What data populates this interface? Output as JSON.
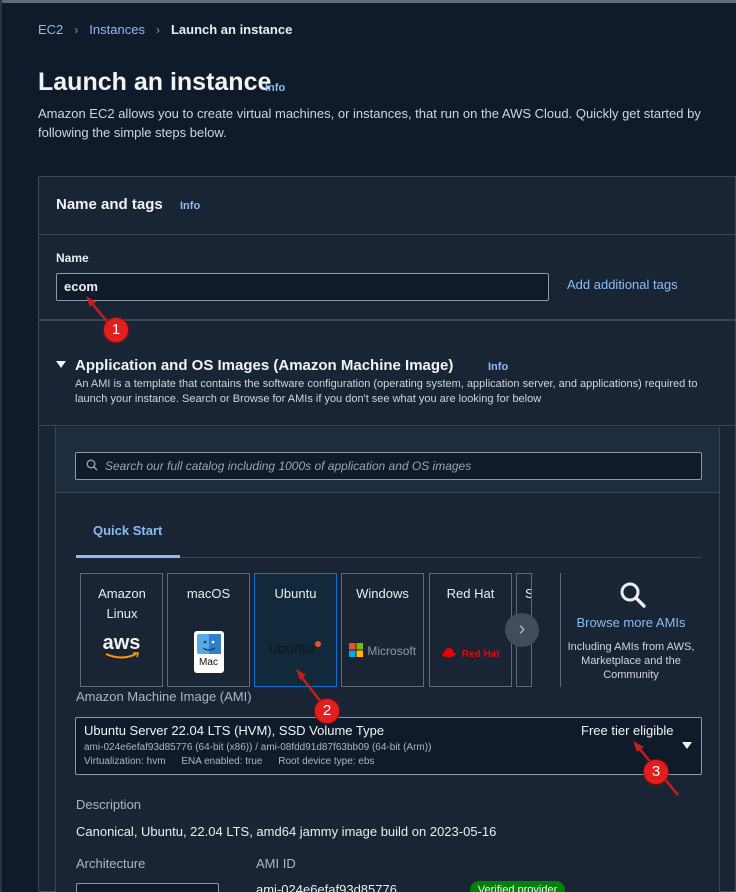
{
  "breadcrumb": {
    "items": [
      "EC2",
      "Instances"
    ],
    "current": "Launch an instance",
    "separator": "›"
  },
  "page": {
    "title": "Launch an instance",
    "info": "Info",
    "description": "Amazon EC2 allows you to create virtual machines, or instances, that run on the AWS Cloud. Quickly get started by following the simple steps below."
  },
  "name_tags": {
    "title": "Name and tags",
    "info": "Info",
    "name_label": "Name",
    "name_value": "ecom",
    "add_tags": "Add additional tags"
  },
  "ami": {
    "title": "Application and OS Images (Amazon Machine Image)",
    "info": "Info",
    "description": "An AMI is a template that contains the software configuration (operating system, application server, and applications) required to launch your instance. Search or Browse for AMIs if you don't see what you are looking for below",
    "search_placeholder": "Search our full catalog including 1000s of application and OS images",
    "tab": "Quick Start",
    "os_options": [
      {
        "label": "Amazon Linux",
        "logo": "aws"
      },
      {
        "label": "macOS",
        "logo": "Mac"
      },
      {
        "label": "Ubuntu",
        "logo": "ubuntu"
      },
      {
        "label": "Windows",
        "logo": "Microsoft"
      },
      {
        "label": "Red Hat",
        "logo": "Red Hat"
      },
      {
        "label": "S",
        "logo": ""
      }
    ],
    "selected_os": "Ubuntu",
    "browse": {
      "label": "Browse more AMIs",
      "sub": "Including AMIs from AWS, Marketplace and the Community"
    },
    "field_label": "Amazon Machine Image (AMI)",
    "selected_ami": {
      "name": "Ubuntu Server 22.04 LTS (HVM), SSD Volume Type",
      "ids": "ami-024e6efaf93d85776 (64-bit (x86)) / ami-08fdd91d87f63bb09 (64-bit (Arm))",
      "virtualization": "Virtualization: hvm",
      "ena": "ENA enabled: true",
      "root_device": "Root device type: ebs",
      "free_tier": "Free tier eligible"
    },
    "description_label": "Description",
    "description_value": "Canonical, Ubuntu, 22.04 LTS, amd64 jammy image build on 2023-05-16",
    "architecture_label": "Architecture",
    "ami_id_label": "AMI ID",
    "ami_id_value": "ami-024e6efaf93d85776",
    "verified_badge": "Verified provider"
  },
  "annotations": [
    "1",
    "2",
    "3"
  ],
  "colors": {
    "link": "#89bdf5",
    "background": "#0f1b2a",
    "panel": "#192534",
    "marker": "#e01f1f",
    "verified": "#037f0c"
  }
}
